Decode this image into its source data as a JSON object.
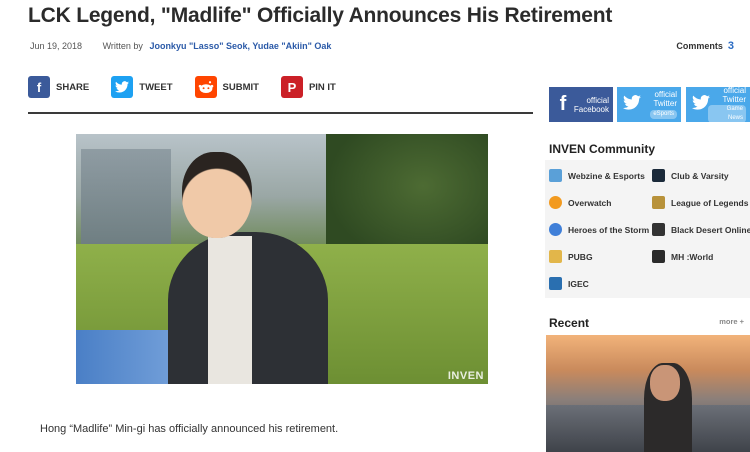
{
  "article": {
    "title": "LCK Legend, \"Madlife\" Officially Announces His Retirement",
    "date": "Jun 19, 2018",
    "written_by_label": "Written by",
    "authors": "Joonkyu \"Lasso\" Seok,  Yudae \"Akiin\" Oak",
    "comments_label": "Comments",
    "comments_count": "3",
    "photo_watermark": "INVEN",
    "caption": "Hong “Madlife” Min-gi has officially announced his retirement."
  },
  "share": [
    {
      "label": "SHARE",
      "icon": "facebook-icon",
      "glyph": "f"
    },
    {
      "label": "TWEET",
      "icon": "twitter-icon",
      "glyph": "🐦"
    },
    {
      "label": "SUBMIT",
      "icon": "reddit-icon",
      "glyph": "◉"
    },
    {
      "label": "PIN IT",
      "icon": "pinterest-icon",
      "glyph": "P"
    }
  ],
  "sidebar": {
    "social": [
      {
        "line1": "official",
        "line2": "Facebook",
        "sub": "",
        "icon": "facebook-icon"
      },
      {
        "line1": "official",
        "line2": "Twitter",
        "sub": "eSports",
        "icon": "twitter-icon"
      },
      {
        "line1": "official",
        "line2": "Twitter",
        "sub": "Game News",
        "icon": "twitter-icon"
      }
    ],
    "community_title": "INVEN Community",
    "community": [
      {
        "label": "Webzine & Esports",
        "color": "#5aa0d8"
      },
      {
        "label": "Club & Varsity",
        "color": "#1b2a3a"
      },
      {
        "label": "Overwatch",
        "color": "#f29a1f"
      },
      {
        "label": "League of Legends",
        "color": "#b8923a"
      },
      {
        "label": "Heroes of the Storm",
        "color": "#3f7fd8"
      },
      {
        "label": "Black Desert Online",
        "color": "#333333"
      },
      {
        "label": "PUBG",
        "color": "#e2b64a"
      },
      {
        "label": "MH :World",
        "color": "#2b2b2b"
      },
      {
        "label": "IGEC",
        "color": "#2a6fb0"
      }
    ],
    "recent_title": "Recent",
    "more_label": "more +"
  }
}
